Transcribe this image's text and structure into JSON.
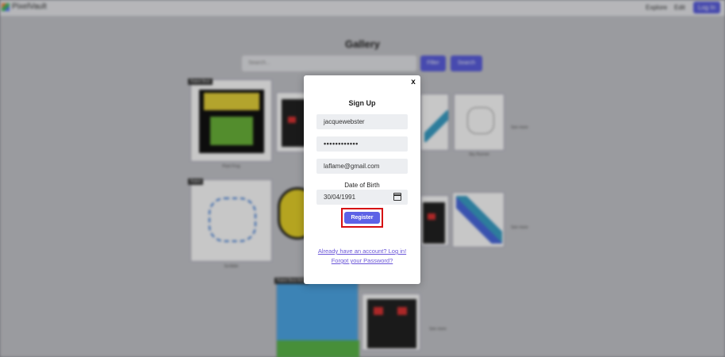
{
  "navbar": {
    "brand": "PixelVault",
    "links": [
      "Explore",
      "Edit"
    ],
    "login_label": "Log In"
  },
  "gallery": {
    "title": "Gallery",
    "search_placeholder": "Search...",
    "filter_label": "Filter",
    "search_label": "Search",
    "tags": [
      "Rated Best",
      "Rated",
      "Rated Best Artist"
    ],
    "captions": [
      "Pixel Frog",
      "Sky Runner",
      "Scribble",
      "See more",
      "See more",
      "See more"
    ]
  },
  "signup": {
    "close_label": "x",
    "title": "Sign Up",
    "username_value": "jacquewebster",
    "password_value": "••••••••••••",
    "email_value": "laflame@gmail.com",
    "dob_label": "Date of Birth",
    "dob_value": "30/04/1991",
    "register_label": "Register",
    "login_link": "Already have an account? Log in!",
    "forgot_link": "Forgot your Password?"
  },
  "colors": {
    "accent": "#5d62e6",
    "highlight": "#d60f12",
    "link": "#6a55d8"
  }
}
